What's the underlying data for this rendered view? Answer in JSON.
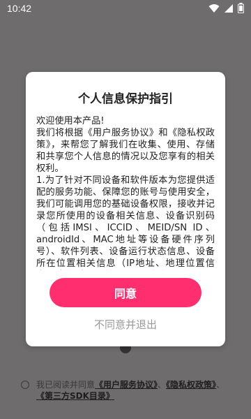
{
  "status": {
    "time": "10:42",
    "icons": [
      "wifi-icon",
      "signal-icon",
      "battery-icon"
    ]
  },
  "dialog": {
    "title": "个人信息保护指引",
    "paragraphs": [
      "欢迎使用本产品!",
      "我们将根据《用户服务协议》和《隐私权政策》，来帮您了解我们在收集、使用、存储和共享您个人信息的情况以及您享有的相关权利。",
      "1.为了针对不同设备和软件版本为您提供适配的服务功能、保障您的账号与使用安全，我们可能调用您的基础设备权限，接收并记录您所使用的设备相关信息、设备识别码（包括IMSI、ICCID、MEID/SN ID、androidId、MAC地址等设备硬件序列号）、软件列表、设备运行状态信息、设备所在位置相关信息（IP地址、地理位置信息）、拨打电话和管理通话：如您使"
    ],
    "agree_button": "同意",
    "decline_button": "不同意并退出"
  },
  "footer": {
    "agree_prefix": "我已阅读并同意",
    "link_service": "《用户服务协议》",
    "sep1": "、",
    "link_privacy": "《隐私权政策》",
    "sep2": "、",
    "link_sdk": "《第三方SDK目录》"
  },
  "colors": {
    "accent": "#ff2f6f",
    "overlay": "#6e6c6c"
  }
}
